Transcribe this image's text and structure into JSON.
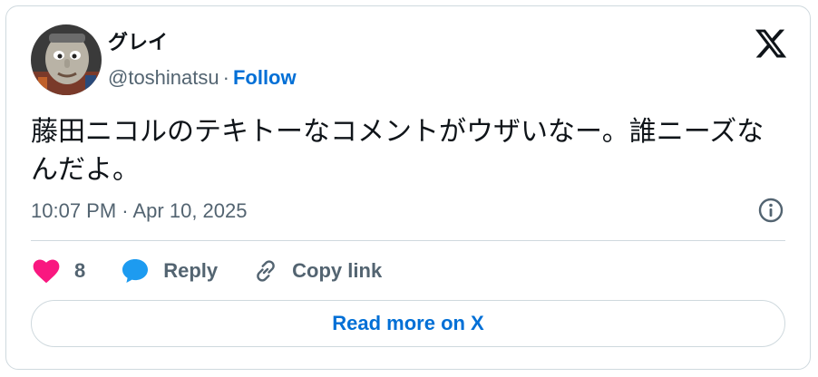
{
  "author": {
    "display_name": "グレイ",
    "handle": "@toshinatsu",
    "separator": "·",
    "follow_label": "Follow",
    "avatar_icon": "avatar-face-icon"
  },
  "tweet": {
    "text": "藤田ニコルのテキトーなコメントがウザいなー。誰ニーズなんだよ。",
    "timestamp": "10:07 PM · Apr 10, 2025"
  },
  "actions": {
    "like_count": "8",
    "reply_label": "Reply",
    "copy_link_label": "Copy link"
  },
  "read_more_label": "Read more on X",
  "icons": {
    "brand": "x-logo-icon",
    "info": "info-icon",
    "like": "heart-icon",
    "reply": "speech-bubble-icon",
    "copy": "link-icon"
  },
  "colors": {
    "like": "#f91880",
    "reply": "#1d9bf0",
    "link": "#006fd6",
    "muted": "#536471",
    "text": "#0f1419",
    "border": "#cfd9de"
  }
}
